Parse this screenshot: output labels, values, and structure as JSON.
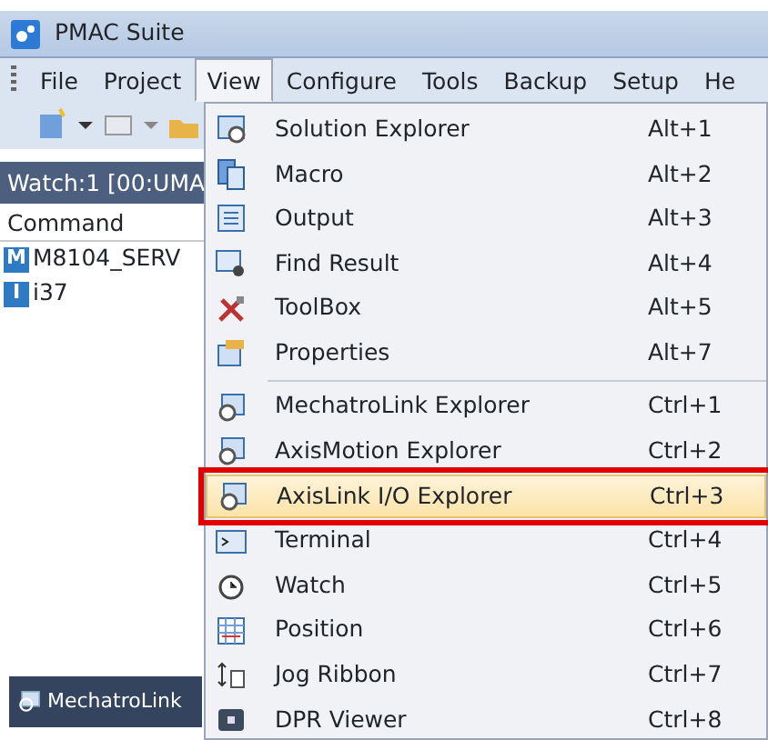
{
  "window": {
    "title": "PMAC Suite"
  },
  "menu_bar": [
    {
      "label": "File",
      "selected": false
    },
    {
      "label": "Project",
      "selected": false
    },
    {
      "label": "View",
      "selected": true
    },
    {
      "label": "Configure",
      "selected": false
    },
    {
      "label": "Tools",
      "selected": false
    },
    {
      "label": "Backup",
      "selected": false
    },
    {
      "label": "Setup",
      "selected": false
    },
    {
      "label": "He",
      "selected": false
    }
  ],
  "watch_panel": {
    "title": "Watch:1 [00:UMA",
    "column": "Command",
    "rows": [
      {
        "badge": "M",
        "text": "M8104_SERV"
      },
      {
        "badge": "I",
        "text": "i37"
      }
    ]
  },
  "bottom_tab": {
    "label": "MechatroLink"
  },
  "view_menu": [
    {
      "kind": "item",
      "label": "Solution Explorer",
      "shortcut": "Alt+1",
      "selected": false,
      "outlined": false
    },
    {
      "kind": "item",
      "label": "Macro",
      "shortcut": "Alt+2",
      "selected": false,
      "outlined": false
    },
    {
      "kind": "item",
      "label": "Output",
      "shortcut": "Alt+3",
      "selected": false,
      "outlined": false
    },
    {
      "kind": "item",
      "label": "Find Result",
      "shortcut": "Alt+4",
      "selected": false,
      "outlined": false
    },
    {
      "kind": "item",
      "label": "ToolBox",
      "shortcut": "Alt+5",
      "selected": false,
      "outlined": false
    },
    {
      "kind": "item",
      "label": "Properties",
      "shortcut": "Alt+7",
      "selected": false,
      "outlined": false
    },
    {
      "kind": "separator"
    },
    {
      "kind": "item",
      "label": "MechatroLink Explorer",
      "shortcut": "Ctrl+1",
      "selected": false,
      "outlined": false
    },
    {
      "kind": "item",
      "label": "AxisMotion Explorer",
      "shortcut": "Ctrl+2",
      "selected": false,
      "outlined": false
    },
    {
      "kind": "item",
      "label": "AxisLink I/O Explorer",
      "shortcut": "Ctrl+3",
      "selected": true,
      "outlined": true
    },
    {
      "kind": "item",
      "label": "Terminal",
      "shortcut": "Ctrl+4",
      "selected": false,
      "outlined": false
    },
    {
      "kind": "item",
      "label": "Watch",
      "shortcut": "Ctrl+5",
      "selected": false,
      "outlined": false
    },
    {
      "kind": "item",
      "label": "Position",
      "shortcut": "Ctrl+6",
      "selected": false,
      "outlined": false
    },
    {
      "kind": "item",
      "label": "Jog Ribbon",
      "shortcut": "Ctrl+7",
      "selected": false,
      "outlined": false
    },
    {
      "kind": "item",
      "label": "DPR Viewer",
      "shortcut": "Ctrl+8",
      "selected": false,
      "outlined": false
    }
  ]
}
